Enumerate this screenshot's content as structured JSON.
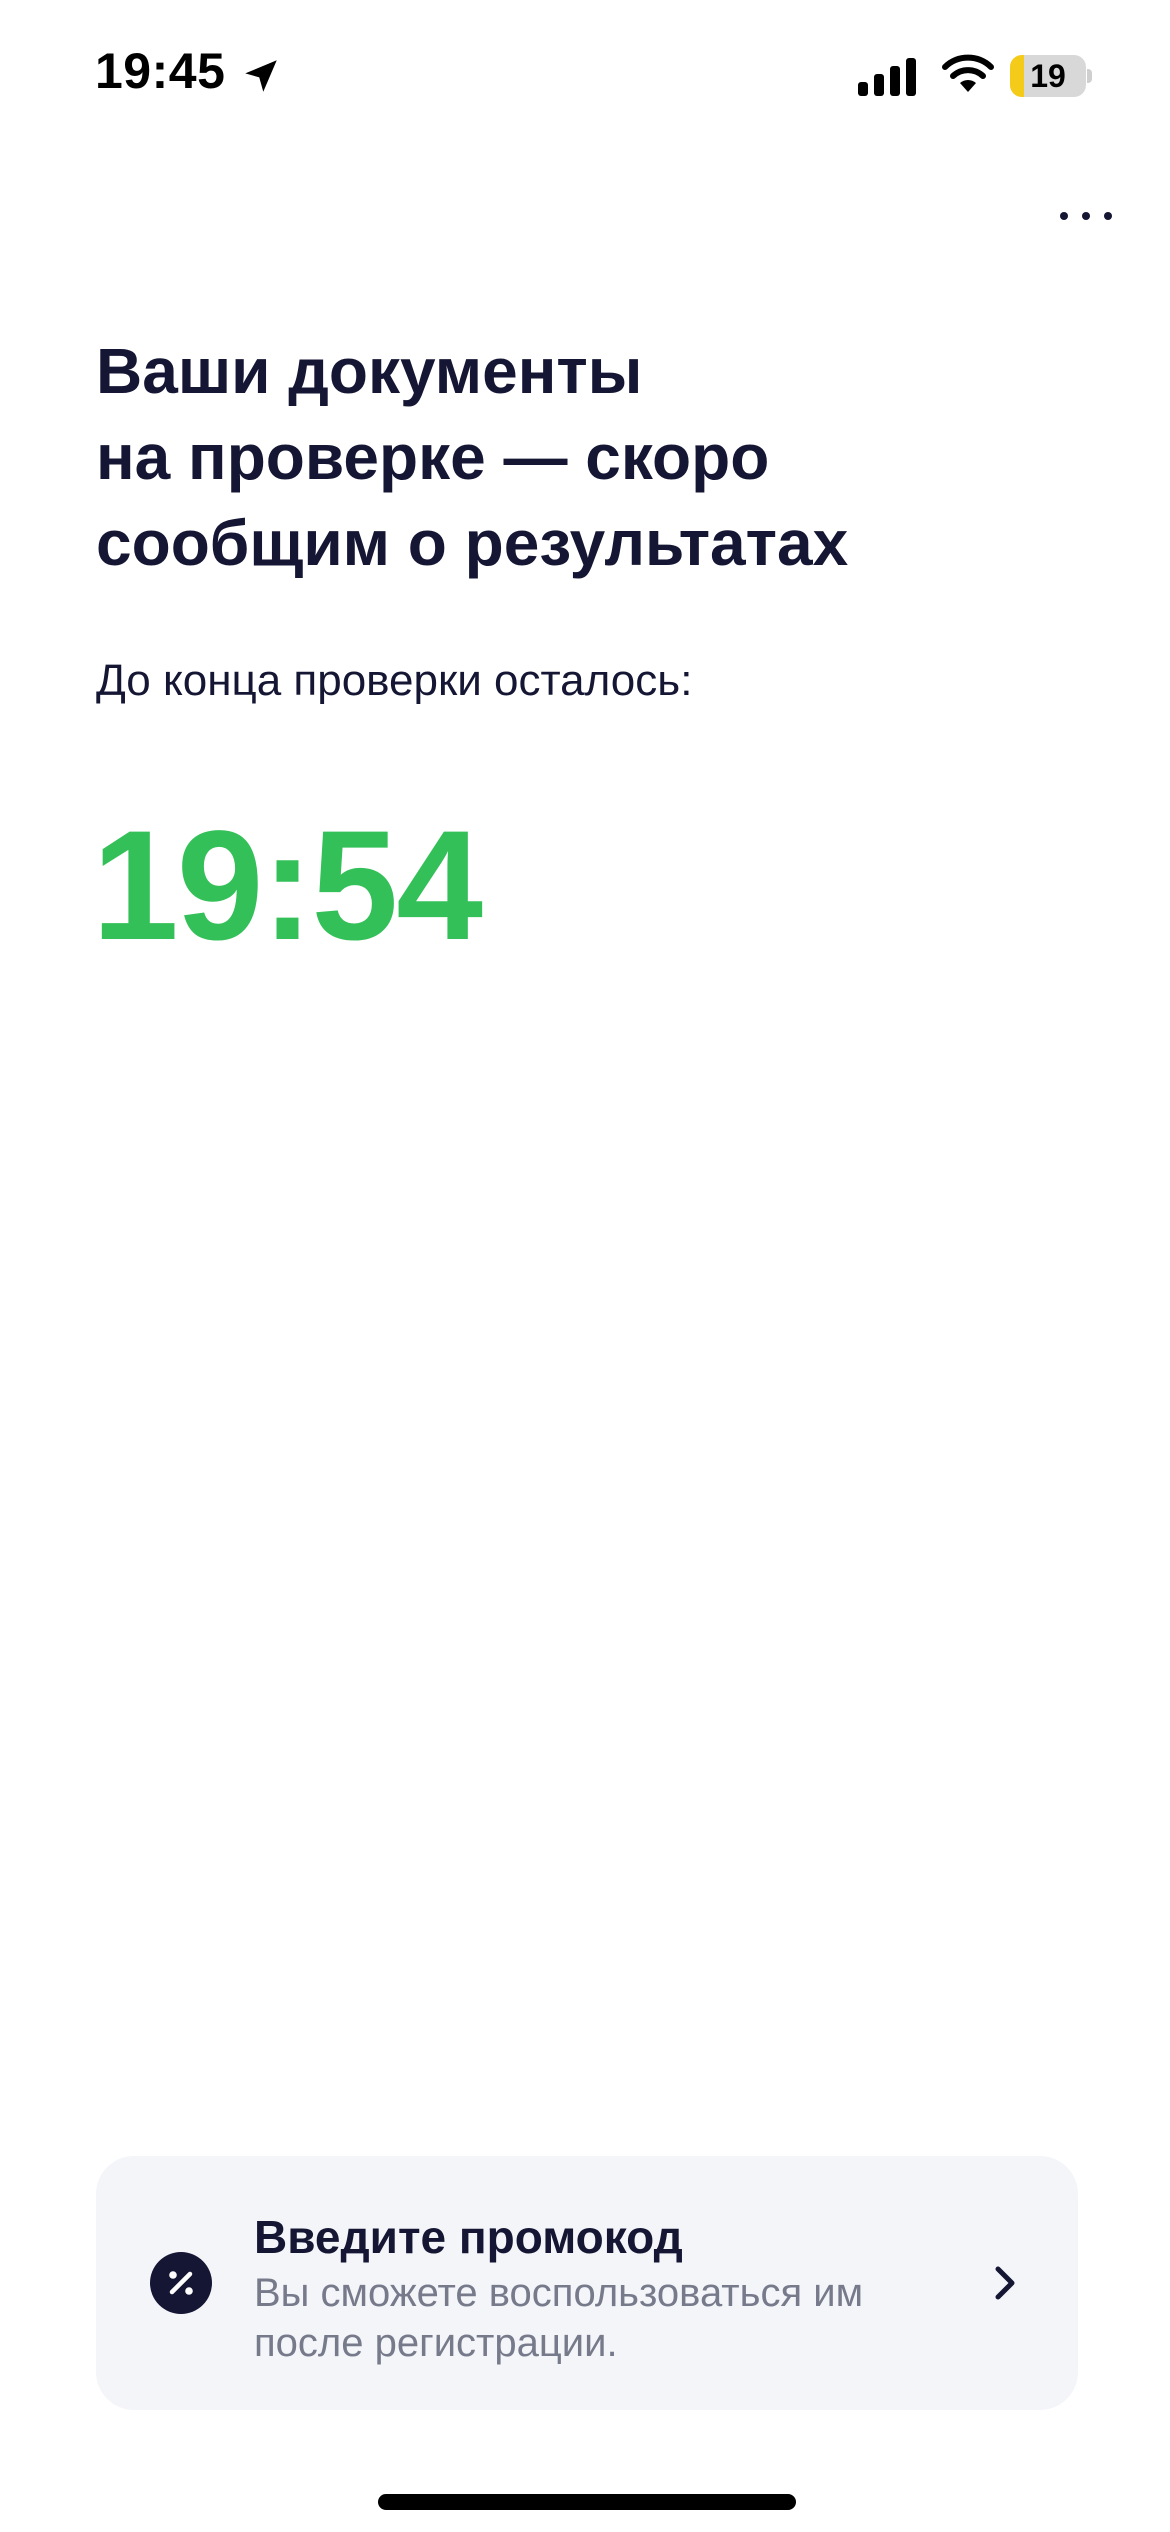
{
  "status_bar": {
    "time": "19:45",
    "battery_level": "19",
    "battery_fraction": 0.19,
    "icons": [
      "location-arrow-icon",
      "cellular-signal-icon",
      "wifi-icon",
      "battery-icon"
    ]
  },
  "header": {
    "more_icon": "more-horizontal-icon"
  },
  "main": {
    "title": "Ваши документы\nна проверке — скоро\nсообщим о результатах",
    "countdown_label": "До конца проверки осталось:",
    "countdown_value": "19:54"
  },
  "promo": {
    "icon": "percent-badge-icon",
    "title": "Введите промокод",
    "description": "Вы сможете воспользоваться им после регистрации.",
    "chevron_icon": "chevron-right-icon"
  },
  "colors": {
    "text_primary": "#151634",
    "text_secondary": "#767a8b",
    "timer_green": "#34c058",
    "card_background": "#f4f5f9",
    "battery_yellow": "#f5cb1a"
  }
}
